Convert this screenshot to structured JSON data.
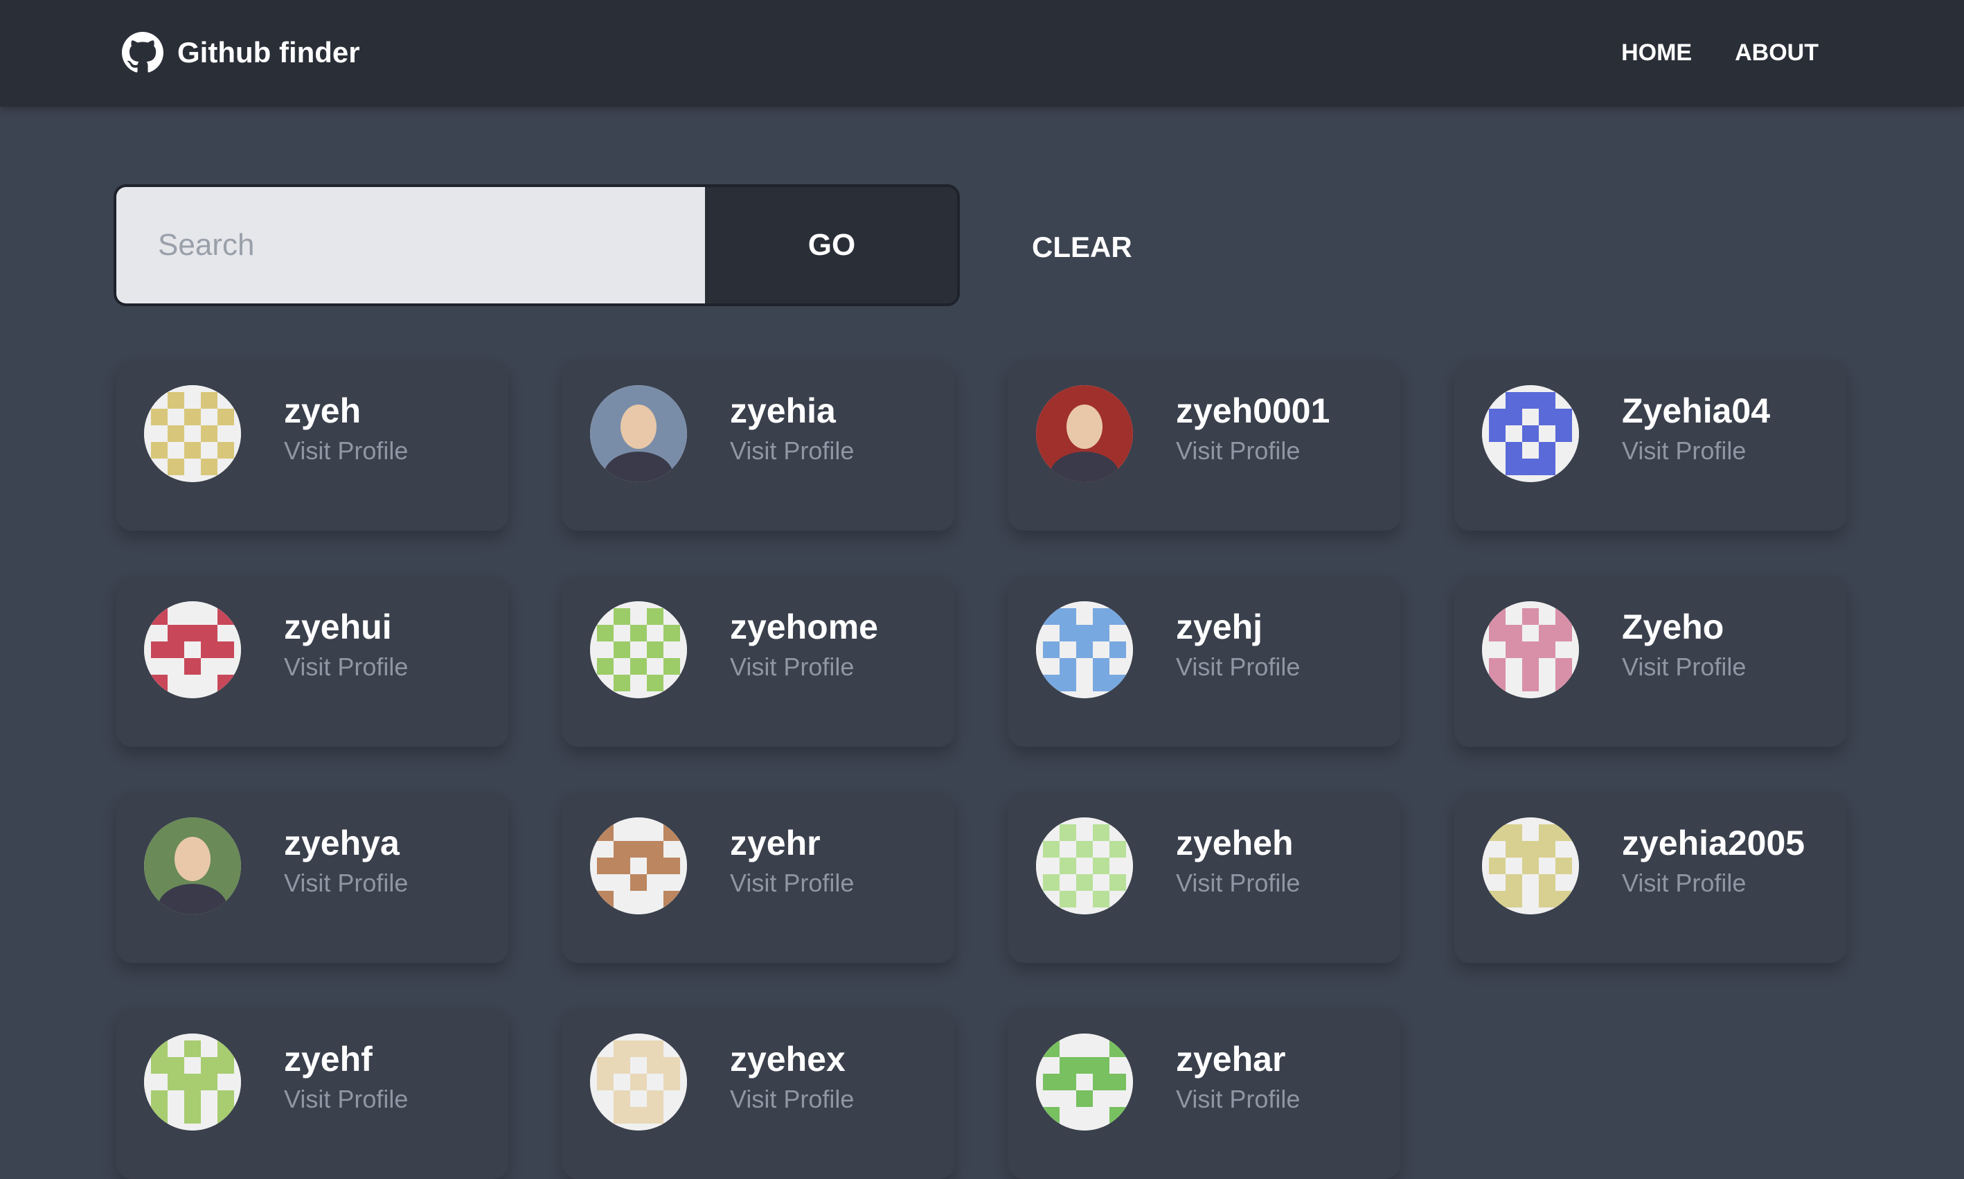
{
  "navbar": {
    "brand_icon": "github-icon",
    "title": "Github finder",
    "links": [
      "HOME",
      "ABOUT"
    ]
  },
  "search": {
    "placeholder": "Search",
    "value": "",
    "go_label": "GO",
    "clear_label": "CLEAR"
  },
  "users": [
    {
      "login": "zyeh",
      "link_text": "Visit Profile",
      "avatar": "identicon",
      "color": "#d8c77a"
    },
    {
      "login": "zyehia",
      "link_text": "Visit Profile",
      "avatar": "photo",
      "color": "#7a8da8"
    },
    {
      "login": "zyeh0001",
      "link_text": "Visit Profile",
      "avatar": "photo",
      "color": "#a0302c"
    },
    {
      "login": "Zyehia04",
      "link_text": "Visit Profile",
      "avatar": "identicon",
      "color": "#5a6ad8"
    },
    {
      "login": "zyehui",
      "link_text": "Visit Profile",
      "avatar": "identicon",
      "color": "#c8485a"
    },
    {
      "login": "zyehome",
      "link_text": "Visit Profile",
      "avatar": "identicon",
      "color": "#9ccc68"
    },
    {
      "login": "zyehj",
      "link_text": "Visit Profile",
      "avatar": "identicon",
      "color": "#78a8e0"
    },
    {
      "login": "Zyeho",
      "link_text": "Visit Profile",
      "avatar": "identicon",
      "color": "#d890a8"
    },
    {
      "login": "zyehya",
      "link_text": "Visit Profile",
      "avatar": "photo",
      "color": "#6a8a58"
    },
    {
      "login": "zyehr",
      "link_text": "Visit Profile",
      "avatar": "identicon",
      "color": "#bc8660"
    },
    {
      "login": "zyeheh",
      "link_text": "Visit Profile",
      "avatar": "identicon",
      "color": "#b8e098"
    },
    {
      "login": "zyehia2005",
      "link_text": "Visit Profile",
      "avatar": "identicon",
      "color": "#d8d090"
    },
    {
      "login": "zyehf",
      "link_text": "Visit Profile",
      "avatar": "identicon",
      "color": "#a8cc70"
    },
    {
      "login": "zyehex",
      "link_text": "Visit Profile",
      "avatar": "identicon",
      "color": "#e8d8b8"
    },
    {
      "login": "zyehar",
      "link_text": "Visit Profile",
      "avatar": "identicon",
      "color": "#78c060"
    }
  ]
}
